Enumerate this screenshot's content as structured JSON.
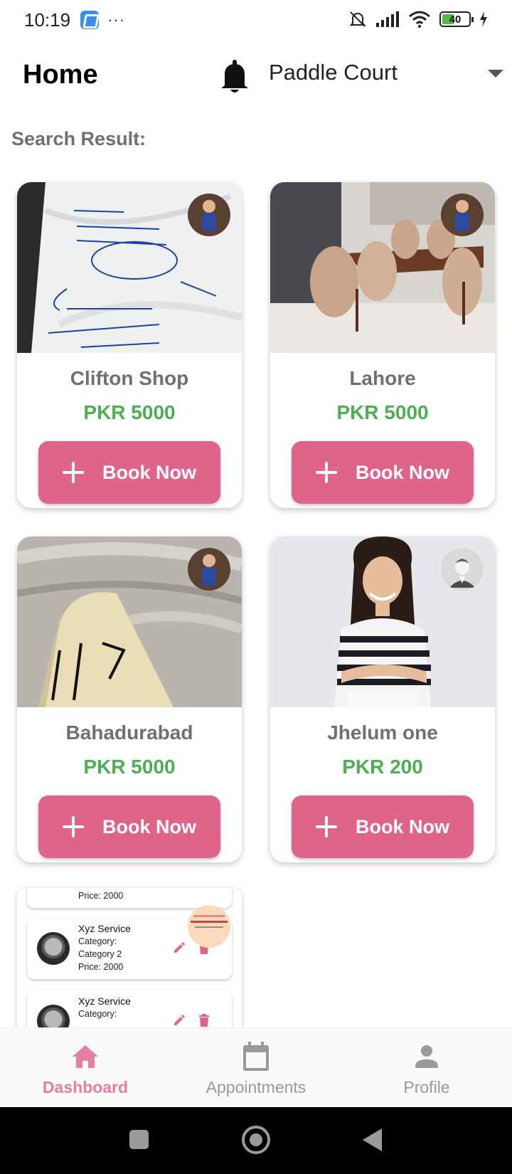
{
  "status_bar": {
    "time": "10:19",
    "dots": "···",
    "battery": "40"
  },
  "header": {
    "title": "Home",
    "location_selected": "Paddle Court"
  },
  "search": {
    "label": "Search Result:"
  },
  "cards": [
    {
      "name": "Clifton Shop",
      "price": "PKR 5000",
      "button": "Book Now",
      "image": "whiteboard-notes"
    },
    {
      "name": "Lahore",
      "price": "PKR 5000",
      "button": "Book Now",
      "image": "dining-room"
    },
    {
      "name": "Bahadurabad",
      "price": "PKR 5000",
      "button": "Book Now",
      "image": "paper-note"
    },
    {
      "name": "Jhelum one",
      "price": "PKR 200",
      "button": "Book Now",
      "image": "woman-portrait"
    }
  ],
  "services": [
    {
      "price": "Price: 2000"
    },
    {
      "title": "Xyz Service",
      "category_label": "Category:",
      "category": "Category 2",
      "price": "Price: 2000"
    },
    {
      "title": "Xyz Service",
      "category_label": "Category:"
    }
  ],
  "bottom_nav": {
    "items": [
      {
        "label": "Dashboard",
        "icon": "home-icon",
        "active": true
      },
      {
        "label": "Appointments",
        "icon": "calendar-icon",
        "active": false
      },
      {
        "label": "Profile",
        "icon": "person-icon",
        "active": false
      }
    ]
  },
  "colors": {
    "accent": "#e0638a",
    "price": "#4caf50",
    "nav_active": "#e47ea2",
    "muted_text": "#707070"
  }
}
